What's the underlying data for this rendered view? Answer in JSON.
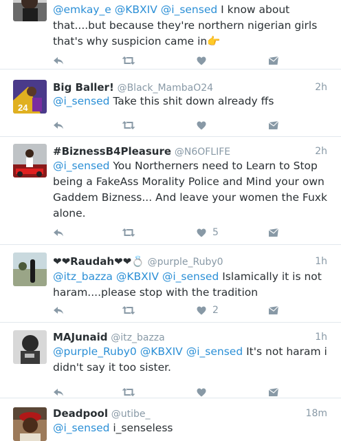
{
  "tweets": [
    {
      "name": "",
      "handle": "",
      "time": "",
      "text_parts": [
        {
          "t": "@emkay_e",
          "m": true
        },
        {
          "t": " ",
          "m": false
        },
        {
          "t": "@KBXIV",
          "m": true
        },
        {
          "t": " ",
          "m": false
        },
        {
          "t": "@i_sensed",
          "m": true
        },
        {
          "t": " I know about that....but because they're northern nigerian girls that's why suspicion came in👉",
          "m": false
        }
      ],
      "like_count": ""
    },
    {
      "name": "Big Baller!",
      "handle": "@Black_MambaO24",
      "time": "2h",
      "text_parts": [
        {
          "t": "@i_sensed",
          "m": true
        },
        {
          "t": " Take this shit down already ffs",
          "m": false
        }
      ],
      "like_count": ""
    },
    {
      "name": "#BiznessB4Pleasure",
      "handle": "@N6OFLIFE",
      "time": "2h",
      "text_parts": [
        {
          "t": "@i_sensed",
          "m": true
        },
        {
          "t": " You Northerners need to Learn to Stop being a FakeAss Morality Police and Mind your own Gaddem Bizness... And leave your women the Fuxk alone.",
          "m": false
        }
      ],
      "like_count": "5"
    },
    {
      "name": "❤❤Raudah❤❤💍",
      "handle": "@purple_Ruby0",
      "time": "1h",
      "text_parts": [
        {
          "t": "@itz_bazza",
          "m": true
        },
        {
          "t": " ",
          "m": false
        },
        {
          "t": "@KBXIV",
          "m": true
        },
        {
          "t": " ",
          "m": false
        },
        {
          "t": "@i_sensed",
          "m": true
        },
        {
          "t": " Islamically it is not haram....please stop with the tradition",
          "m": false
        }
      ],
      "like_count": "2"
    },
    {
      "name": "MAJunaid",
      "handle": "@itz_bazza",
      "time": "1h",
      "text_parts": [
        {
          "t": "@purple_Ruby0",
          "m": true
        },
        {
          "t": " ",
          "m": false
        },
        {
          "t": "@KBXIV",
          "m": true
        },
        {
          "t": " ",
          "m": false
        },
        {
          "t": "@i_sensed",
          "m": true
        },
        {
          "t": " It's not haram i didn't say it too sister.",
          "m": false
        }
      ],
      "like_count": ""
    },
    {
      "name": "Deadpool",
      "handle": "@utibe_",
      "time": "18m",
      "text_parts": [
        {
          "t": "@i_sensed",
          "m": true
        },
        {
          "t": " i_senseless",
          "m": false
        }
      ],
      "like_count": ""
    }
  ],
  "icons": {
    "reply": "reply-icon",
    "retweet": "retweet-icon",
    "like": "heart-icon",
    "dm": "direct-message-icon"
  },
  "colors": {
    "mention": "#2b8fd6",
    "muted": "#8899a6",
    "text": "#292f33",
    "divider": "#e1e8ed"
  }
}
